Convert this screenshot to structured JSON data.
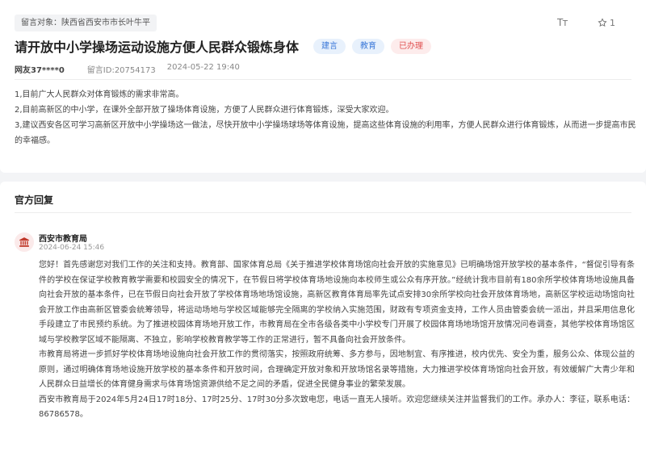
{
  "message": {
    "target_label": "留言对象：陕西省西安市市长叶牛平",
    "title": "请开放中小学操场运动设施方便人民群众锻炼身体",
    "tags": [
      "建言",
      "教育",
      "已办理"
    ],
    "author": "网友37****0",
    "id": "留言ID:20754173",
    "time": "2024-05-22 19:40",
    "font_size_icon": "Tт",
    "favorite_count": "1",
    "content": [
      "1,目前广大人民群众对体育锻炼的需求非常高。",
      "2,目前高新区的中小学，在课外全部开放了操场体育设施，方便了人民群众进行体育锻炼，深受大家欢迎。",
      "3,建议西安各区可学习高新区开放中小学操场这一做法，尽快开放中小学操场球场等体育设施，提高这些体育设施的利用率，方便人民群众进行体育锻炼，从而进一步提高市民的幸福感。"
    ]
  },
  "reply": {
    "heading": "官方回复",
    "org": "西安市教育局",
    "time": "2024-06-24 15:46",
    "paragraphs": [
      "您好！首先感谢您对我们工作的关注和支持。教育部、国家体育总局《关于推进学校体育场馆向社会开放的实施意见》已明确场馆开放学校的基本条件，“督促引导有条件的学校在保证学校教育教学需要和校园安全的情况下，在节假日将学校体育场地设施向本校师生或公众有序开放。”经统计我市目前有180余所学校体育场地设施具备向社会开放的基本条件，已在节假日向社会开放了学校体育场地场馆设施，高新区教育体育局率先试点安排30余所学校向社会开放体育场地，高新区学校运动场馆向社会开放工作由高新区管委会统筹领导，将运动场地与学校区域能够完全隔离的学校纳入实施范围，财政有专项资金支持，工作人员由管委会统一派出，并且采用信息化手段建立了市民预约系统。为了推进校园体育场地开放工作，市教育局在全市各级各类中小学校专门开展了校园体育场地场馆开放情况问卷调查，其他学校体育场馆区域与学校教学区域不能隔离、不独立，影响学校教育教学等工作的正常进行，暂不具备向社会开放条件。",
      "市教育局将进一步抓好学校体育场地设施向社会开放工作的贯彻落实，按照政府统筹、多方参与，因地制宜、有序推进，校内优先、安全为重，服务公众、体现公益的原则，通过明确体育场地设施开放学校的基本条件和开放时间，合理确定开放对象和开放场馆名录等措施，大力推进学校体育场馆向社会开放，有效缓解广大青少年和人民群众日益增长的体育健身需求与体育场馆资源供给不足之间的矛盾，促进全民健身事业的繁荣发展。",
      "西安市教育局于2024年5月24日17时18分、17时25分、17时30分多次致电您，电话一直无人接听。欢迎您继续关注并监督我们的工作。承办人：李征，联系电话：86786578。"
    ]
  },
  "colors": {
    "tag_blue_text": "#3a78d8",
    "tag_red_text": "#e05050",
    "avatar_icon": "#c0392b"
  },
  "icons": {
    "font_size": "font-size-icon",
    "favorite": "star-icon",
    "org_avatar": "government-building-icon"
  }
}
